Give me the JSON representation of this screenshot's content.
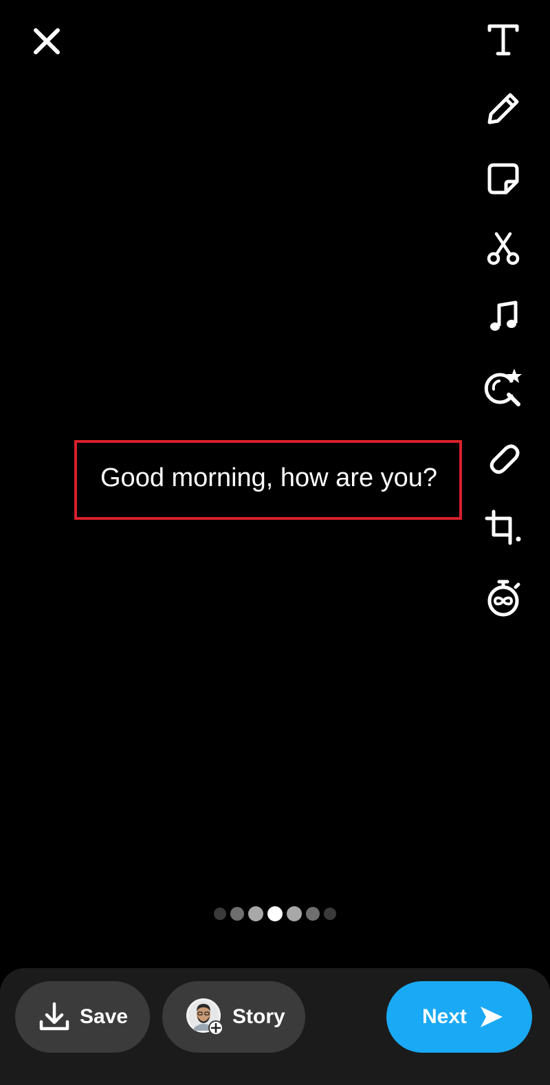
{
  "caption": {
    "text": "Good morning, how are you?"
  },
  "toolbar": {
    "icons": [
      "text-icon",
      "pencil-icon",
      "sticker-icon",
      "scissors-icon",
      "music-note-icon",
      "lens-search-icon",
      "paperclip-icon",
      "crop-icon",
      "timer-infinity-icon"
    ]
  },
  "pager": {
    "count": 7,
    "active_index": 3
  },
  "actions": {
    "save_label": "Save",
    "story_label": "Story",
    "next_label": "Next"
  },
  "colors": {
    "background": "#000000",
    "highlight_border": "#d8202a",
    "next_button": "#1aa9f5",
    "secondary_button": "#3b3b3b",
    "bottom_bar": "#1b1b1b"
  }
}
